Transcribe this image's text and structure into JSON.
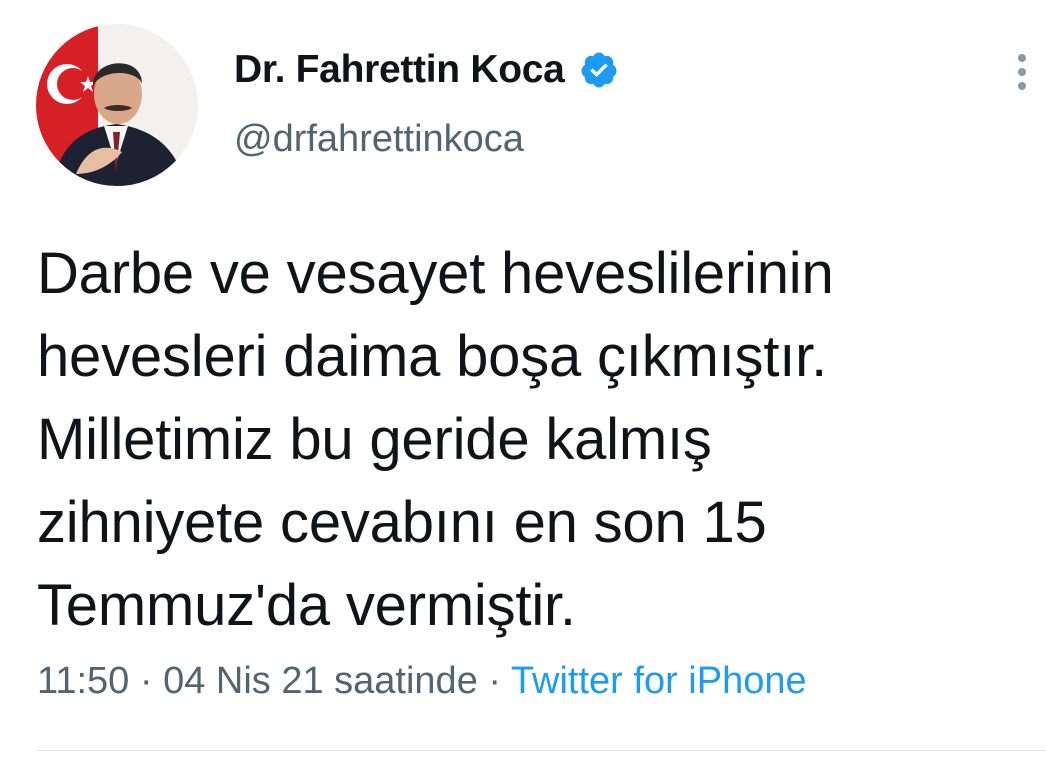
{
  "author": {
    "display_name": "Dr. Fahrettin Koca",
    "handle": "@drfahrettinkoca",
    "avatar_icon": "profile-photo",
    "verified_icon": "verified-badge-icon"
  },
  "tweet": {
    "text": "Darbe ve vesayet heveslilerinin\nhevesleri daima boşa çıkmıştır.\nMilletimiz bu geride kalmış\nzihniyete cevabını en son 15\nTemmuz'da vermiştir.",
    "time": "11:50",
    "separator": "·",
    "date_text": "04 Nis 21 saatinde",
    "source": "Twitter for iPhone"
  },
  "colors": {
    "text": "#0f1419",
    "secondary": "#536471",
    "link": "#1d9bf0",
    "verified": "#1d9bf0"
  },
  "icons": {
    "more": "more-vertical-icon"
  }
}
